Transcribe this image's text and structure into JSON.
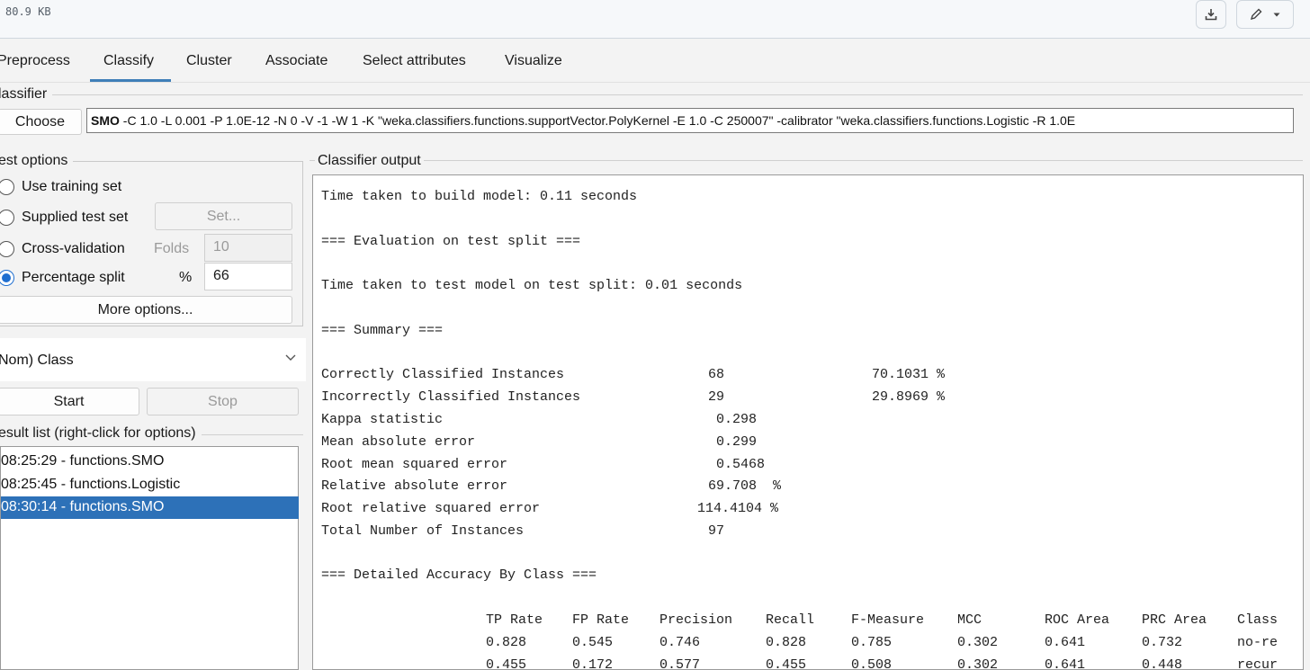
{
  "file_bar": {
    "size": "80.9 KB",
    "download_icon": "download-icon",
    "edit_icon": "pencil-icon",
    "menu_icon": "caret-down-icon"
  },
  "tabs": [
    "Preprocess",
    "Classify",
    "Cluster",
    "Associate",
    "Select attributes",
    "Visualize"
  ],
  "active_tab": "Classify",
  "classifier": {
    "group_label": "lassifier",
    "choose_label": "Choose",
    "name": "SMO",
    "args": " -C 1.0 -L 0.001 -P 1.0E-12 -N 0 -V -1 -W 1 -K \"weka.classifiers.functions.supportVector.PolyKernel -E 1.0 -C 250007\" -calibrator \"weka.classifiers.functions.Logistic -R 1.0E"
  },
  "test_options": {
    "group_label": "est options",
    "use_training": "Use training set",
    "supplied": "Supplied test set",
    "set_button": "Set...",
    "cross_validation": "Cross-validation",
    "folds_label": "Folds",
    "folds_value": "10",
    "percentage_split": "Percentage split",
    "percent_label": "%",
    "percent_value": "66",
    "selected": "Percentage split",
    "more_options": "More options..."
  },
  "class_select": {
    "value": "Nom) Class"
  },
  "actions": {
    "start": "Start",
    "stop": "Stop"
  },
  "result_list": {
    "label": "esult list (right-click for options)",
    "items": [
      "08:25:29 - functions.SMO",
      "08:25:45 - functions.Logistic",
      "08:30:14 - functions.SMO"
    ],
    "selected_index": 2
  },
  "output": {
    "label": "Classifier output",
    "lines": [
      "Time taken to build model: 0.11 seconds",
      "=== Evaluation on test split ===",
      "Time taken to test model on test split: 0.01 seconds",
      "=== Summary ==="
    ],
    "summary": [
      {
        "label": "Correctly Classified Instances",
        "value": "68",
        "pct": "70.1031 %"
      },
      {
        "label": "Incorrectly Classified Instances",
        "value": "29",
        "pct": "29.8969 %"
      },
      {
        "label": "Kappa statistic",
        "value": " 0.298",
        "pct": ""
      },
      {
        "label": "Mean absolute error",
        "value": " 0.299",
        "pct": ""
      },
      {
        "label": "Root mean squared error",
        "value": " 0.5468",
        "pct": ""
      },
      {
        "label": "Relative absolute error",
        "value": "69.708  %",
        "pct": ""
      },
      {
        "label": "Root relative squared error",
        "value": "114.4104 %",
        "pct": ""
      },
      {
        "label": "Total Number of Instances",
        "value": "97",
        "pct": ""
      }
    ],
    "detailed_header": "=== Detailed Accuracy By Class ===",
    "table_columns": [
      "TP Rate",
      "FP Rate",
      "Precision",
      "Recall",
      "F-Measure",
      "MCC",
      "ROC Area",
      "PRC Area",
      "Class"
    ],
    "table_rows": [
      [
        "0.828",
        "0.545",
        "0.746",
        "0.828",
        "0.785",
        "0.302",
        "0.641",
        "0.732",
        "no-re"
      ],
      [
        "0.455",
        "0.172",
        "0.577",
        "0.455",
        "0.508",
        "0.302",
        "0.641",
        "0.448",
        "recur"
      ]
    ]
  }
}
